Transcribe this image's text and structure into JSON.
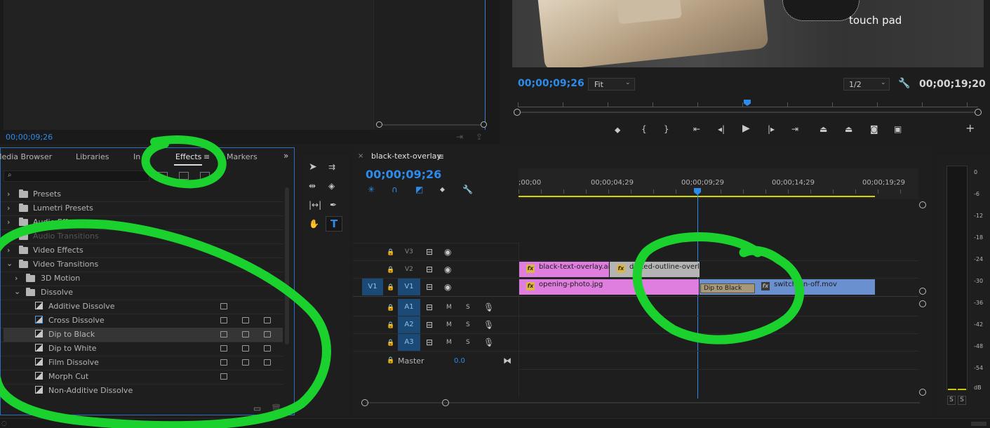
{
  "source_monitor": {
    "timecode": "00;00;09;26"
  },
  "program_monitor": {
    "video_caption": "touch pad",
    "timecode": "00;00;09;26",
    "fit_label": "Fit",
    "resolution_label": "1/2",
    "duration": "00;00;19;20"
  },
  "project_panel": {
    "tabs": [
      {
        "label": "Media Browser"
      },
      {
        "label": "Libraries"
      },
      {
        "label": "In"
      },
      {
        "label": "Effects"
      },
      {
        "label": "Markers"
      }
    ],
    "effects_tree": [
      {
        "label": "Presets"
      },
      {
        "label": "Lumetri Presets"
      },
      {
        "label": "Audio Effects"
      },
      {
        "label": "Audio Transitions"
      },
      {
        "label": "Video Effects"
      },
      {
        "label": "Video Transitions"
      },
      {
        "label": "3D Motion"
      },
      {
        "label": "Dissolve"
      },
      {
        "label": "Additive Dissolve"
      },
      {
        "label": "Cross Dissolve"
      },
      {
        "label": "Dip to Black"
      },
      {
        "label": "Dip to White"
      },
      {
        "label": "Film Dissolve"
      },
      {
        "label": "Morph Cut"
      },
      {
        "label": "Non-Additive Dissolve"
      }
    ]
  },
  "timeline": {
    "sequence_name": "black-text-overlay",
    "timecode": "00;00;09;26",
    "ruler": [
      ";00;00",
      "00;00;04;29",
      "00;00;09;29",
      "00;00;14;29",
      "00;00;19;29"
    ],
    "tracks": {
      "v3": "V3",
      "v2": "V2",
      "v1": "V1",
      "src_v1": "V1",
      "a1": "A1",
      "a2": "A2",
      "a3": "A3",
      "mute": "M",
      "solo": "S",
      "master": "Master",
      "master_value": "0.0"
    },
    "clips": {
      "v2_a": "black-text-overlay.ai",
      "v2_b": "dotted-outline-overlay.ai",
      "v1_a": "opening-photo.jpg",
      "v1_transition": "Dip to Black",
      "v1_b": "switch-on-off.mov",
      "fx": "fx"
    }
  },
  "audio_meter": {
    "scale": [
      "0",
      "-6",
      "-12",
      "-18",
      "-24",
      "-30",
      "-36",
      "-42",
      "-48",
      "-54",
      "dB"
    ],
    "solo_left": "S",
    "solo_right": "S"
  },
  "colors": {
    "accent_blue": "#2d8ceb",
    "annotation_green": "#1bd12e",
    "clip_pink": "#e07ee0",
    "clip_blue": "#6a90d0",
    "clip_gray": "#b4b4b4"
  }
}
